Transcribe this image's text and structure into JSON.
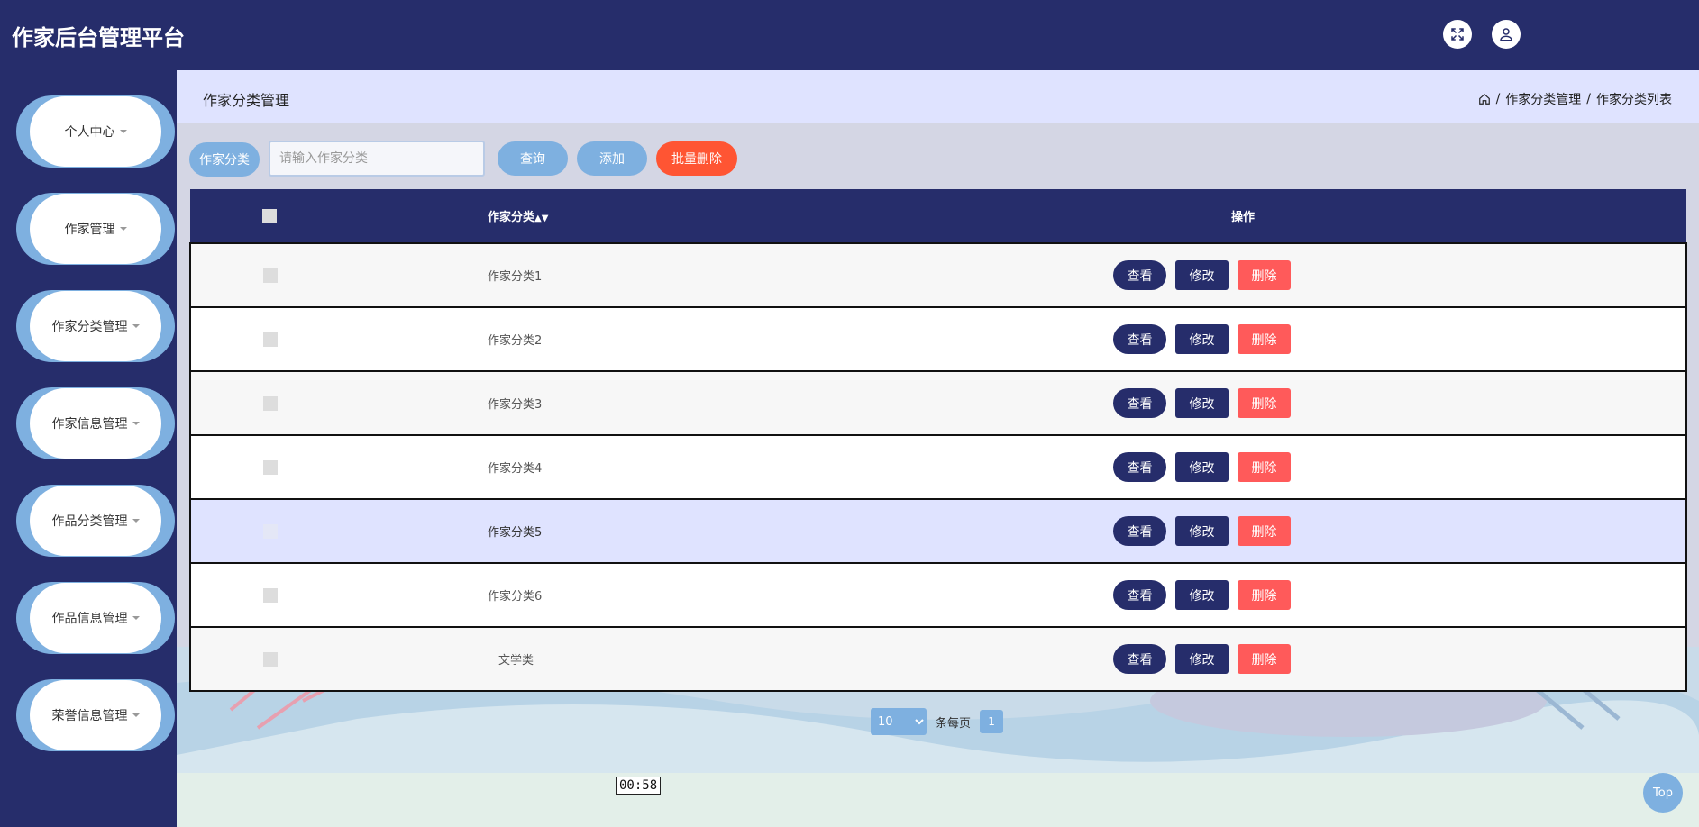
{
  "app": {
    "title": "作家后台管理平台"
  },
  "topbar": {
    "fullscreen_icon": "expand-icon",
    "user_icon": "user-icon"
  },
  "sidebar": {
    "items": [
      {
        "label": "个人中心"
      },
      {
        "label": "作家管理"
      },
      {
        "label": "作家分类管理"
      },
      {
        "label": "作家信息管理"
      },
      {
        "label": "作品分类管理"
      },
      {
        "label": "作品信息管理"
      },
      {
        "label": "荣誉信息管理"
      }
    ]
  },
  "header": {
    "title": "作家分类管理",
    "breadcrumb": {
      "home_icon": "home-icon",
      "sep": "/",
      "level1": "作家分类管理",
      "level2": "作家分类列表"
    }
  },
  "search": {
    "label": "作家分类",
    "placeholder": "请输入作家分类",
    "value": "",
    "query_label": "查询",
    "add_label": "添加",
    "batch_delete_label": "批量删除"
  },
  "table": {
    "headers": {
      "name": "作家分类",
      "sort_icon": "sort-icon",
      "op": "操作"
    },
    "rows": [
      {
        "name": "作家分类1"
      },
      {
        "name": "作家分类2"
      },
      {
        "name": "作家分类3"
      },
      {
        "name": "作家分类4"
      },
      {
        "name": "作家分类5"
      },
      {
        "name": "作家分类6"
      },
      {
        "name": "文学类"
      }
    ],
    "view_label": "查看",
    "edit_label": "修改",
    "delete_label": "删除"
  },
  "pager": {
    "page_size": "10",
    "per_page_label": "条每页",
    "current_page": "1"
  },
  "timer": {
    "text": "00:58"
  },
  "back_to_top": {
    "label": "Top"
  },
  "colors": {
    "primary": "#262d6b",
    "accent": "#7eb0e0",
    "danger": "#ff5a5a",
    "header_bg": "#dfe3ff"
  }
}
